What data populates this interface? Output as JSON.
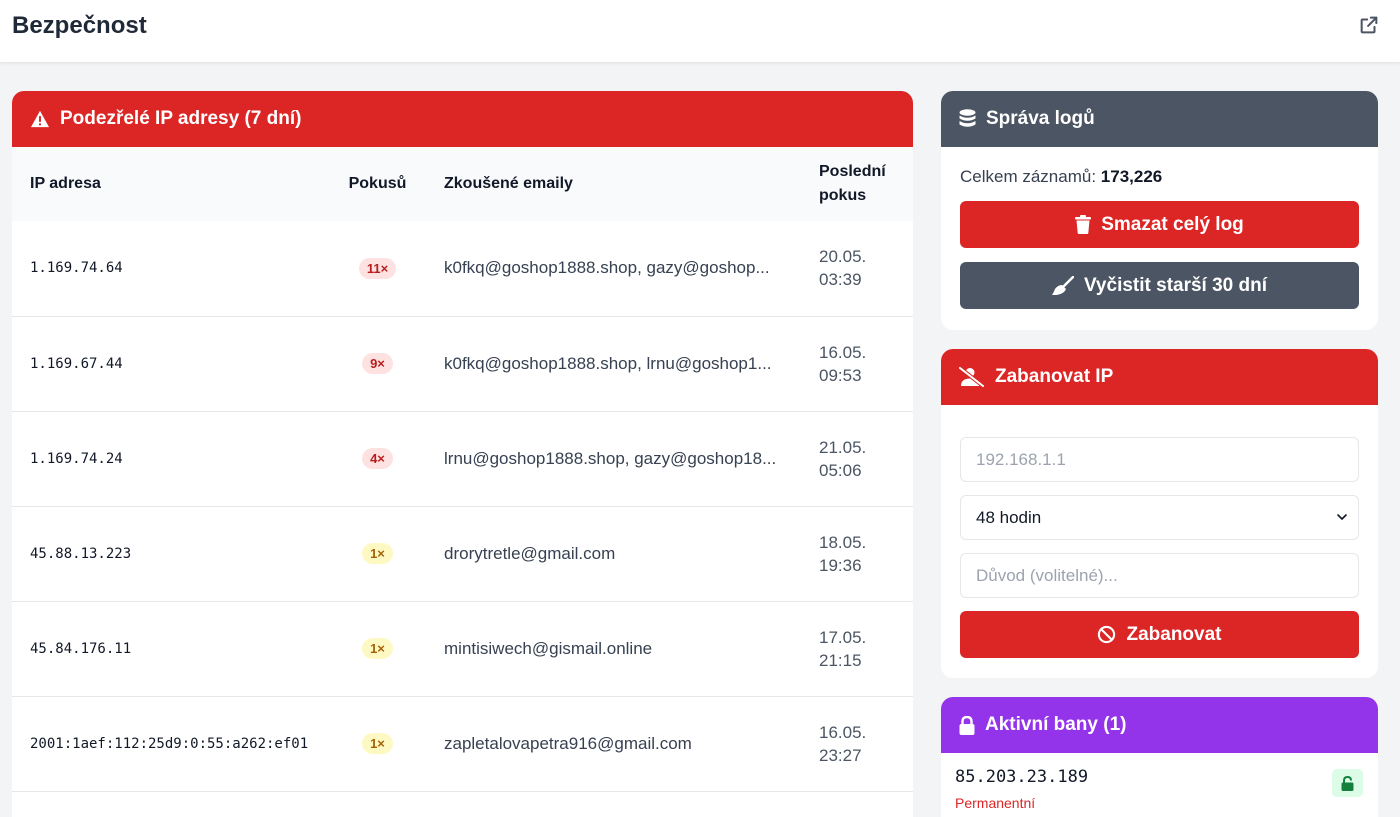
{
  "header": {
    "title": "Bezpečnost",
    "external_link_icon": "external-link-icon"
  },
  "suspicious": {
    "title": "Podezřelé IP adresy (7 dní)",
    "columns": {
      "ip": "IP adresa",
      "attempts": "Pokusů",
      "emails": "Zkoušené emaily",
      "last_line1": "Poslední",
      "last_line2": "pokus"
    },
    "rows": [
      {
        "ip": "1.169.74.64",
        "attempts": "11×",
        "emails": "k0fkq@goshop1888.shop, gazy@goshop...",
        "date": "20.05.",
        "time": "03:39"
      },
      {
        "ip": "1.169.67.44",
        "attempts": "9×",
        "emails": "k0fkq@goshop1888.shop, lrnu@goshop1...",
        "date": "16.05.",
        "time": "09:53"
      },
      {
        "ip": "1.169.74.24",
        "attempts": "4×",
        "emails": "lrnu@goshop1888.shop, gazy@goshop18...",
        "date": "21.05.",
        "time": "05:06"
      },
      {
        "ip": "45.88.13.223",
        "attempts": "1×",
        "emails": "drorytretle@gmail.com",
        "date": "18.05.",
        "time": "19:36"
      },
      {
        "ip": "45.84.176.11",
        "attempts": "1×",
        "emails": "mintisiwech@gismail.online",
        "date": "17.05.",
        "time": "21:15"
      },
      {
        "ip": "2001:1aef:112:25d9:0:55:a262:ef01",
        "attempts": "1×",
        "emails": "zapletalovapetra916@gmail.com",
        "date": "16.05.",
        "time": "23:27"
      }
    ]
  },
  "logs": {
    "title": "Správa logů",
    "count_label": "Celkem záznamů:",
    "count_value": "173,226",
    "delete_label": "Smazat celý log",
    "clean_label": "Vyčistit starší 30 dní"
  },
  "ban": {
    "title": "Zabanovat IP",
    "ip_placeholder": "192.168.1.1",
    "duration_selected": "48 hodin",
    "reason_placeholder": "Důvod (volitelné)...",
    "submit_label": "Zabanovat"
  },
  "active_bans": {
    "title": "Aktivní bany (1)",
    "items": [
      {
        "ip": "85.203.23.189",
        "type": "Permanentní"
      }
    ]
  },
  "colors": {
    "red": "#dc2626",
    "slate": "#4b5563",
    "purple": "#9333ea",
    "badge_high_bg": "#fee2e2",
    "badge_low_bg": "#fef9c3"
  }
}
